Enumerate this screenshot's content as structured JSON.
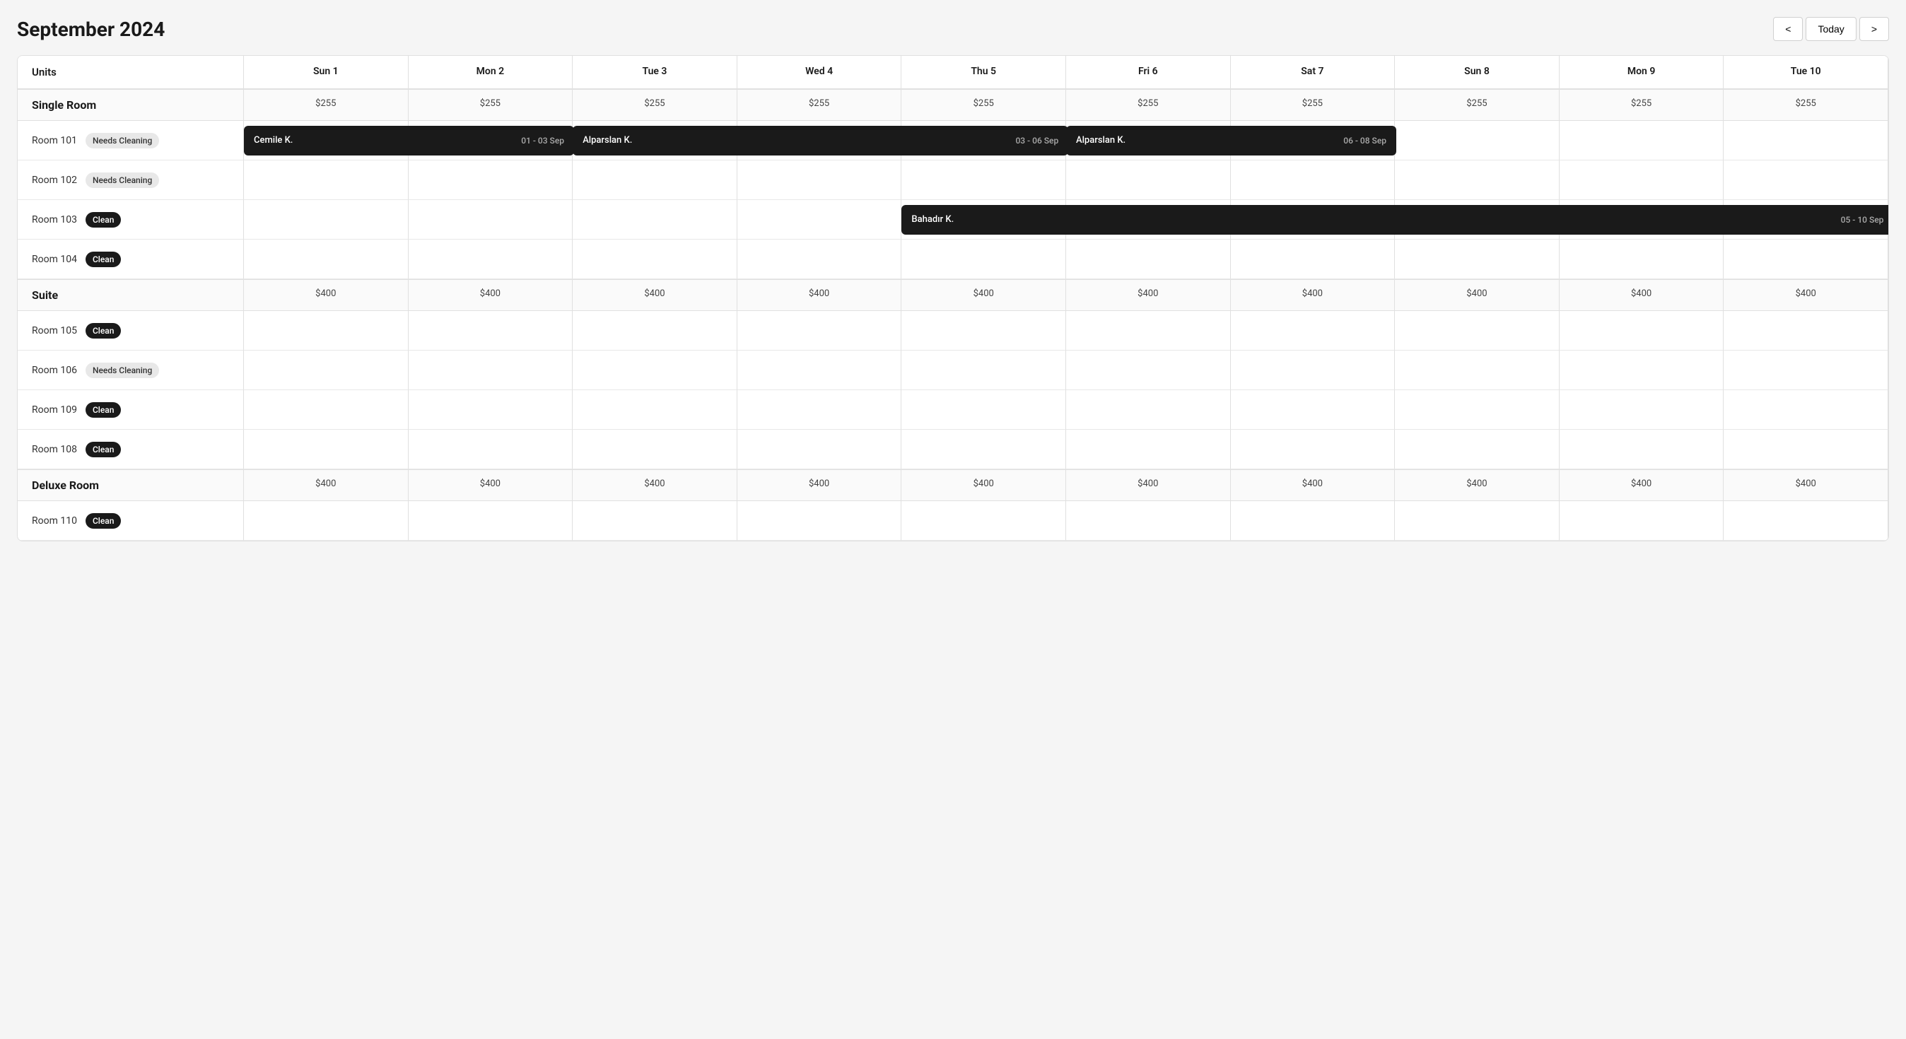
{
  "header": {
    "title": "September 2024",
    "nav": {
      "prev": "<",
      "today": "Today",
      "next": ">"
    }
  },
  "columns": [
    {
      "label": "Units",
      "key": "units"
    },
    {
      "label": "Sun 1",
      "key": "sun1"
    },
    {
      "label": "Mon 2",
      "key": "mon2"
    },
    {
      "label": "Tue 3",
      "key": "tue3"
    },
    {
      "label": "Wed 4",
      "key": "wed4"
    },
    {
      "label": "Thu 5",
      "key": "thu5"
    },
    {
      "label": "Fri 6",
      "key": "fri6"
    },
    {
      "label": "Sat 7",
      "key": "sat7"
    },
    {
      "label": "Sun 8",
      "key": "sun8"
    },
    {
      "label": "Mon 9",
      "key": "mon9"
    },
    {
      "label": "Tue 10",
      "key": "tue10"
    }
  ],
  "categories": [
    {
      "name": "Single Room",
      "price": "$255",
      "rooms": [
        {
          "name": "Room 101",
          "status": "Needs Cleaning",
          "statusType": "needs-cleaning",
          "bookings": [
            {
              "guest": "Cemile K.",
              "dates": "01 - 03 Sep",
              "startCol": 1,
              "spanCols": 2
            },
            {
              "guest": "Alparslan K.",
              "dates": "03 - 06 Sep",
              "startCol": 3,
              "spanCols": 3
            },
            {
              "guest": "Alparslan K.",
              "dates": "06 - 08 Sep",
              "startCol": 6,
              "spanCols": 2
            }
          ]
        },
        {
          "name": "Room 102",
          "status": "Needs Cleaning",
          "statusType": "needs-cleaning",
          "bookings": []
        },
        {
          "name": "Room 103",
          "status": "Clean",
          "statusType": "clean",
          "bookings": [
            {
              "guest": "Bahadır K.",
              "dates": "05 - 10 Sep",
              "startCol": 5,
              "spanCols": 6
            }
          ]
        },
        {
          "name": "Room 104",
          "status": "Clean",
          "statusType": "clean",
          "bookings": []
        }
      ]
    },
    {
      "name": "Suite",
      "price": "$400",
      "rooms": [
        {
          "name": "Room 105",
          "status": "Clean",
          "statusType": "clean",
          "bookings": []
        },
        {
          "name": "Room 106",
          "status": "Needs Cleaning",
          "statusType": "needs-cleaning",
          "bookings": []
        },
        {
          "name": "Room 109",
          "status": "Clean",
          "statusType": "clean",
          "bookings": []
        },
        {
          "name": "Room 108",
          "status": "Clean",
          "statusType": "clean",
          "bookings": []
        }
      ]
    },
    {
      "name": "Deluxe Room",
      "price": "$400",
      "rooms": [
        {
          "name": "Room 110",
          "status": "Clean",
          "statusType": "clean",
          "bookings": []
        }
      ]
    }
  ]
}
